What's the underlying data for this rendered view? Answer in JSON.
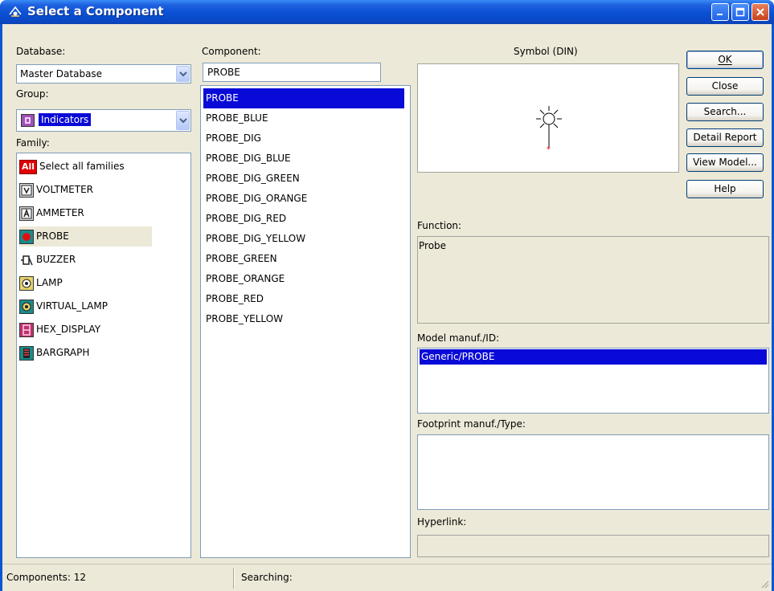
{
  "window": {
    "title": "Select a Component"
  },
  "database": {
    "label": "Database:",
    "value": "Master Database"
  },
  "group": {
    "label": "Group:",
    "value": "Indicators"
  },
  "family": {
    "label": "Family:",
    "items": [
      {
        "label": "Select all families",
        "icon": "all-families-icon",
        "badge": "All"
      },
      {
        "label": "VOLTMETER",
        "icon": "voltmeter-icon"
      },
      {
        "label": "AMMETER",
        "icon": "ammeter-icon"
      },
      {
        "label": "PROBE",
        "icon": "probe-icon"
      },
      {
        "label": "BUZZER",
        "icon": "buzzer-icon"
      },
      {
        "label": "LAMP",
        "icon": "lamp-icon"
      },
      {
        "label": "VIRTUAL_LAMP",
        "icon": "virtual-lamp-icon"
      },
      {
        "label": "HEX_DISPLAY",
        "icon": "hex-display-icon"
      },
      {
        "label": "BARGRAPH",
        "icon": "bargraph-icon"
      }
    ],
    "selected": "PROBE"
  },
  "component": {
    "label": "Component:",
    "value": "PROBE",
    "items": [
      "PROBE",
      "PROBE_BLUE",
      "PROBE_DIG",
      "PROBE_DIG_BLUE",
      "PROBE_DIG_GREEN",
      "PROBE_DIG_ORANGE",
      "PROBE_DIG_RED",
      "PROBE_DIG_YELLOW",
      "PROBE_GREEN",
      "PROBE_ORANGE",
      "PROBE_RED",
      "PROBE_YELLOW"
    ],
    "selected": "PROBE"
  },
  "symbol": {
    "label": "Symbol (DIN)"
  },
  "function": {
    "label": "Function:",
    "value": "Probe"
  },
  "model": {
    "label": "Model manuf./ID:",
    "items": [
      "Generic/PROBE"
    ]
  },
  "footprint": {
    "label": "Footprint manuf./Type:"
  },
  "hyperlink": {
    "label": "Hyperlink:"
  },
  "buttons": {
    "ok": "OK",
    "close": "Close",
    "search": "Search...",
    "detail_report": "Detail Report",
    "view_model": "View Model...",
    "help": "Help"
  },
  "status": {
    "components": "Components: 12",
    "searching": "Searching:"
  },
  "colors": {
    "selection": "#0a0ad8",
    "titlebar": "#0a49c6",
    "face": "#ece9d8"
  }
}
